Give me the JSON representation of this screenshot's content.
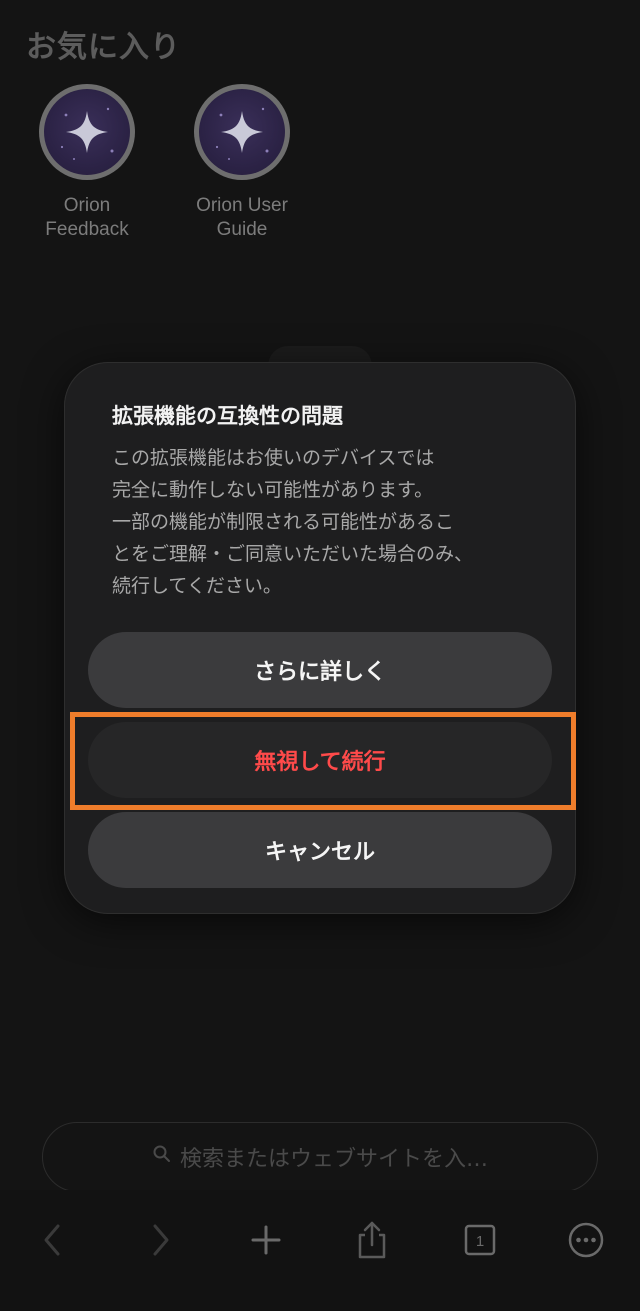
{
  "favorites": {
    "title": "お気に入り",
    "items": [
      {
        "label_line1": "Orion",
        "label_line2": "Feedback",
        "icon": "orion-sparkle-icon"
      },
      {
        "label_line1": "Orion User",
        "label_line2": "Guide",
        "icon": "orion-sparkle-icon"
      }
    ]
  },
  "dialog": {
    "title": "拡張機能の互換性の問題",
    "body_lines": [
      "この拡張機能はお使いのデバイスでは",
      "完全に動作しない可能性があります。",
      "一部の機能が制限される可能性があるこ",
      "とをご理解・ご同意いただいた場合のみ、",
      "続行してください。"
    ],
    "buttons": {
      "learn_more": "さらに詳しく",
      "ignore_continue": "無視して続行",
      "cancel": "キャンセル"
    }
  },
  "search": {
    "placeholder": "検索またはウェブサイトを入…"
  },
  "toolbar": {
    "tabs_count": "1"
  },
  "colors": {
    "highlight": "#ef7d2b",
    "destructive": "#ff4a4a"
  }
}
